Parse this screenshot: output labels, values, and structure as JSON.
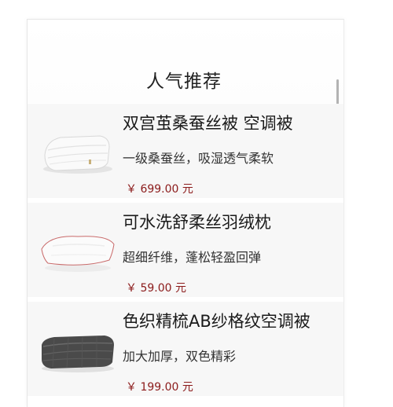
{
  "section": {
    "title": "人气推荐"
  },
  "products": [
    {
      "title": "双宫茧桑蚕丝被 空调被",
      "desc": "一级桑蚕丝，吸湿透气柔软",
      "price": "￥ 699.00 元",
      "image_icon": "white-quilt-image"
    },
    {
      "title": "可水洗舒柔丝羽绒枕",
      "desc": "超细纤维，蓬松轻盈回弹",
      "price": "￥ 59.00 元",
      "image_icon": "white-pillow-image"
    },
    {
      "title": "色织精梳AB纱格纹空调被",
      "desc": "加大加厚，双色精彩",
      "price": "￥ 199.00 元",
      "image_icon": "gray-blanket-image"
    }
  ],
  "colors": {
    "price": "#8b1a1a",
    "item_bg": "#f7f7f7",
    "title": "#1a1a1a"
  }
}
